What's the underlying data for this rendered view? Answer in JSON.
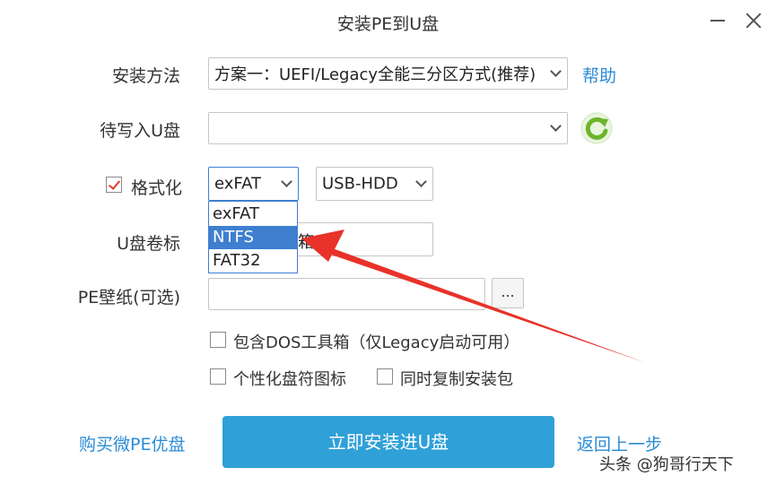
{
  "window": {
    "title": "安装PE到U盘",
    "minimize_icon": "minimize-icon",
    "close_icon": "close-icon"
  },
  "install_method": {
    "label": "安装方法",
    "value": "方案一：UEFI/Legacy全能三分区方式(推荐)",
    "help_link": "帮助"
  },
  "target_disk": {
    "label": "待写入U盘",
    "value": "",
    "refresh_icon": "refresh-icon",
    "refresh_color": "#6cb52d"
  },
  "format": {
    "label": "格式化",
    "checked": true,
    "fs_selected": "exFAT",
    "fs_options": [
      "exFAT",
      "NTFS",
      "FAT32"
    ],
    "fs_highlighted": "NTFS",
    "mode_selected": "USB-HDD"
  },
  "volume_label": {
    "label": "U盘卷标",
    "value_partial": "箱"
  },
  "wallpaper": {
    "label": "PE壁纸(可选)",
    "value": "",
    "browse_label": "..."
  },
  "options": {
    "dos_tools": {
      "label": "包含DOS工具箱（仅Legacy启动可用）",
      "checked": false
    },
    "custom_icon": {
      "label": "个性化盘符图标",
      "checked": false
    },
    "copy_package": {
      "label": "同时复制安装包",
      "checked": false
    }
  },
  "footer": {
    "buy_link": "购买微PE优盘",
    "install_button": "立即安装进U盘",
    "back_link": "返回上一步"
  },
  "watermark": "头条 @狗哥行天下",
  "colors": {
    "accent": "#2fa0d8",
    "link": "#2a8bd6",
    "selection": "#3f7fd0",
    "annotation_arrow": "#e8322a"
  }
}
